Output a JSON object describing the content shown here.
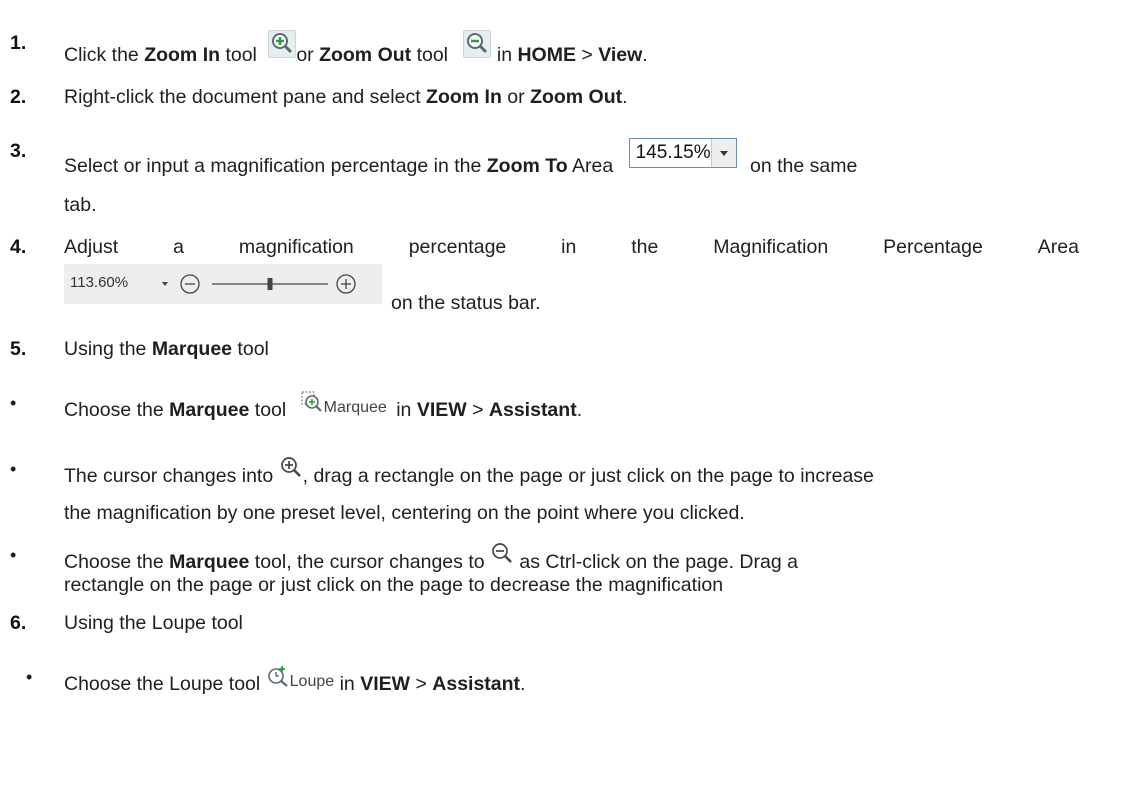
{
  "steps": {
    "s1": {
      "num": "1.",
      "a": "Click the ",
      "b": "Zoom In",
      "c": " tool",
      "d": "or ",
      "e": "Zoom Out",
      "f": " tool",
      "g": " in ",
      "h": "HOME",
      "i": " > ",
      "j": "View",
      "k": "."
    },
    "s2": {
      "num": "2.",
      "a": "Right-click the document pane and select ",
      "b": "Zoom In",
      "c": " or ",
      "d": "Zoom Out",
      "e": "."
    },
    "s3": {
      "num": "3.",
      "a": "Select or input a magnification percentage in the ",
      "b": "Zoom To",
      "c": " Area",
      "zoom_value": "145.15%",
      "d": " on the same",
      "e": "tab."
    },
    "s4": {
      "num": "4.",
      "words": [
        "Adjust",
        "a",
        "magnification",
        "percentage",
        "in",
        "the",
        "Magnification",
        "Percentage",
        "Area"
      ],
      "status_value": "113.60%",
      "slider_fraction": 0.5,
      "e": "on the status bar."
    },
    "s5": {
      "num": "5.",
      "a": "Using the ",
      "b": "Marquee",
      "c": " tool"
    },
    "b1": {
      "a": "Choose the ",
      "b": "Marquee",
      "c": " tool",
      "icon_label": "Marquee",
      "d": "in ",
      "e": "VIEW",
      "f": " > ",
      "g": "Assistant",
      "h": "."
    },
    "b2": {
      "a": "The cursor changes into ",
      "b": ", drag a rectangle on the page or just click on the page to increase",
      "c": "the magnification by one preset level, centering on the point where you clicked."
    },
    "b3": {
      "a": "Choose the ",
      "b": "Marquee",
      "c": " tool, the cursor changes to ",
      "d": " as Ctrl-click on the page. Drag a",
      "e": "rectangle on the page or just click on the page to decrease the magnification"
    },
    "s6": {
      "num": "6.",
      "a": "Using the Loupe tool"
    },
    "b4": {
      "a": "Choose the Loupe tool ",
      "icon_label": "Loupe",
      "b": "in ",
      "c": "VIEW",
      "d": " > ",
      "e": "Assistant",
      "f": "."
    }
  },
  "bullet_char": "•",
  "icons": [
    "zoom-in-icon",
    "zoom-out-icon",
    "dropdown-arrow-icon",
    "minus-circle-icon",
    "plus-circle-icon",
    "marquee-icon",
    "loupe-icon"
  ],
  "colors": {
    "text": "#1f1f1f",
    "icon_green": "#2e9c3e",
    "icon_gray": "#5a6a73",
    "statusbar_bg": "#eeeeee"
  }
}
